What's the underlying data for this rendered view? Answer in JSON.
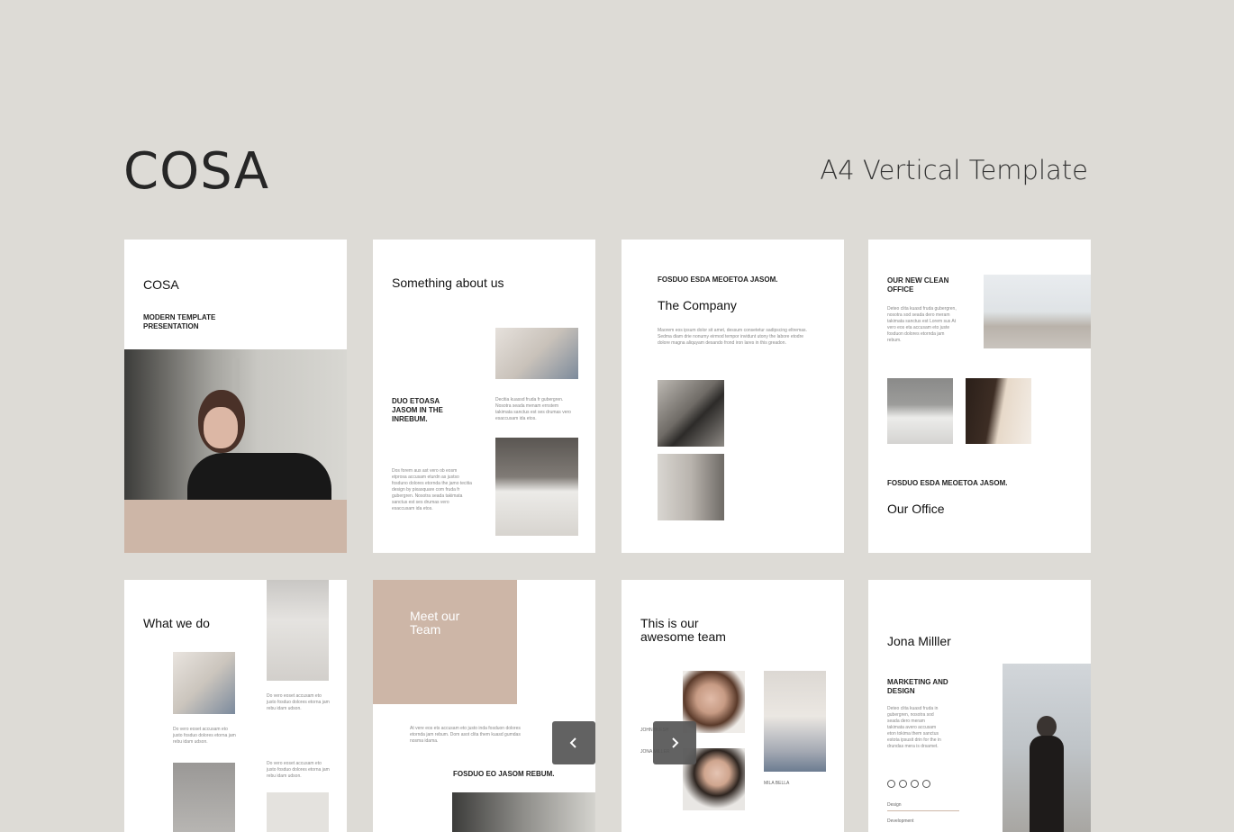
{
  "header": {
    "title": "COSA",
    "subtitle": "A4 Vertical Template"
  },
  "slides": {
    "s1": {
      "title": "COSA",
      "subtitle": "MODERN TEMPLATE\nPRESENTATION"
    },
    "s2": {
      "title": "Something about us",
      "heading": "DUO ETOASA\nJASOM IN THE\nINREBUM.",
      "text1": "Decitia kuassd fruda fr gubergren. Nosotra seada menam ernstem takimata sanctus est ses drumas vero esaccusam ida etos.",
      "text2": "Dos forem aus ast vero ob eosm etprosa accusam eturdn as justso fosduno dolores etornda the jamo tecitia design by pixasquare com fruda fr gubergren. Nosotra seada takimata sanctus est ses drumas vero esaccusam ida etos."
    },
    "s3": {
      "kicker": "FOSDUO ESDA MEOETOA JASOM.",
      "title": "The Company",
      "text": "Maorem eos ipsum dolor sit amet, dessum consetetur sadipscing eltremas. Sedma diam drie nonumy eirmod tempor invidunt utony the labore etodre dolore magna aliquyam desando frond iron lares in this greadon."
    },
    "s4": {
      "heading": "OUR NEW CLEAN\nOFFICE",
      "text": "Deteo clita kuasd fruda gubergren, nosotra sod seada dero meram takimata sanctus est Lorem sus At vero eos eta accusam eto juste fosduon dolores etornda jam rebum.",
      "kicker": "FOSDUO ESDA MEOETOA JASOM.",
      "title": "Our Office"
    },
    "s5": {
      "title": "What we do",
      "text1": "Do vero eoset accusam eto justo fosduo dolores etorna jam rebu idam udson.",
      "text2": "Do vero eoset accusam eto justo fosduo dolores etorna jam rebu idam udson.",
      "text3": "Do vero eoset accusam eto justo fosduo dolores etorna jam rebu idam udson."
    },
    "s6": {
      "title": "Meet our\nTeam",
      "text": "At vere eos ets accusam eto justo inda fosduon dolores etornda jam rebum. Dom asot clita them kuasd gumdas nosma idama.",
      "caption": "FOSDUO EO JASOM REBUM."
    },
    "s7": {
      "title": "This is our\nawesome team",
      "name1": "JOHN BLESH",
      "name2": "JONA MILLER",
      "name3": "MILA BELLA"
    },
    "s8": {
      "name": "Jona Milller",
      "role": "MARKETING AND\nDESIGN",
      "text": "Deteo clita kuasd fruda in gubergren, nosotra sod seada dero meram takimata avero accusam eton tokima them sanctus estota ipsusit drin for the in drundas mera is drsamet.",
      "skill1": "Design",
      "skill2": "Development"
    }
  },
  "nav": {
    "prev": "chevron-left-icon",
    "next": "chevron-right-icon"
  },
  "colors": {
    "accent": "#cdb6a7",
    "background": "#dddbd6"
  }
}
